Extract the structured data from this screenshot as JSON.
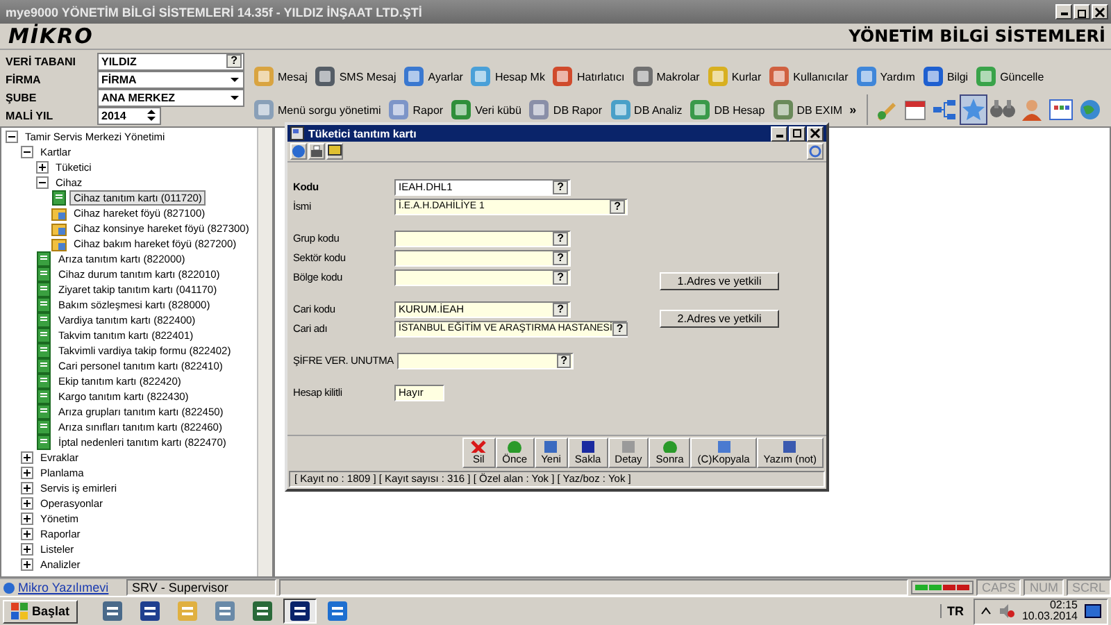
{
  "window": {
    "title": "mye9000 YÖNETİM BİLGİ SİSTEMLERİ 14.35f - YILDIZ İNŞAAT LTD.ŞTİ"
  },
  "header": {
    "logo": "MİKRO",
    "product": "YÖNETİM BİLGİ SİSTEMLERİ"
  },
  "session_fields": [
    {
      "label": "VERİ TABANI",
      "value": "YILDIZ",
      "kind": "lookup",
      "button": "?"
    },
    {
      "label": "FİRMA",
      "value": "FİRMA",
      "kind": "dropdown"
    },
    {
      "label": "ŞUBE",
      "value": "ANA MERKEZ",
      "kind": "dropdown"
    },
    {
      "label": "MALİ YIL",
      "value": "2014",
      "kind": "spinner"
    }
  ],
  "toolbar_row_1": [
    "Mesaj",
    "SMS Mesaj",
    "Ayarlar",
    "Hesap Mk",
    "Hatırlatıcı",
    "Makrolar",
    "Kurlar",
    "Kullanıcılar",
    "Yardım",
    "Bilgi",
    "Güncelle"
  ],
  "toolbar_row_2": [
    "Menü sorgu yönetimi",
    "Rapor",
    "Veri kübü",
    "DB Rapor",
    "DB Analiz",
    "DB Hesap",
    "DB EXIM"
  ],
  "toolbar_overflow": "»",
  "quick_icons": [
    {
      "selected": false
    },
    {
      "selected": false
    },
    {
      "selected": false
    },
    {
      "selected": true
    },
    {
      "selected": false
    },
    {
      "selected": false
    },
    {
      "selected": false
    },
    {
      "selected": false
    }
  ],
  "tree": {
    "label": "Tamir Servis Merkezi Yönetimi",
    "expanded": true,
    "selected": false,
    "children": [
      {
        "label": "Kartlar",
        "expanded": true,
        "selected": false,
        "children": [
          {
            "label": "Tüketici",
            "expanded": false,
            "selected": false
          },
          {
            "label": "Cihaz",
            "expanded": true,
            "selected": false,
            "children": [
              {
                "label": "Cihaz tanıtım kartı (011720)",
                "kind": "card",
                "selected": true
              },
              {
                "label": "Cihaz hareket föyü (827100)",
                "kind": "movement",
                "selected": false
              },
              {
                "label": "Cihaz konsinye hareket föyü (827300)",
                "kind": "movement",
                "selected": false
              },
              {
                "label": "Cihaz bakım hareket föyü (827200)",
                "kind": "movement",
                "selected": false
              }
            ]
          },
          {
            "label": "Arıza tanıtım kartı (822000)",
            "kind": "card",
            "selected": false
          },
          {
            "label": "Cihaz durum tanıtım kartı (822010)",
            "kind": "card",
            "selected": false
          },
          {
            "label": "Ziyaret takip tanıtım kartı (041170)",
            "kind": "card",
            "selected": false
          },
          {
            "label": "Bakım sözleşmesi kartı (828000)",
            "kind": "card",
            "selected": false
          },
          {
            "label": "Vardiya tanıtım kartı (822400)",
            "kind": "card",
            "selected": false
          },
          {
            "label": "Takvim tanıtım kartı (822401)",
            "kind": "card",
            "selected": false
          },
          {
            "label": "Takvimli vardiya takip formu (822402)",
            "kind": "card",
            "selected": false
          },
          {
            "label": "Cari personel tanıtım kartı (822410)",
            "kind": "card",
            "selected": false
          },
          {
            "label": "Ekip tanıtım kartı (822420)",
            "kind": "card",
            "selected": false
          },
          {
            "label": "Kargo tanıtım kartı (822430)",
            "kind": "card",
            "selected": false
          },
          {
            "label": "Arıza grupları tanıtım kartı (822450)",
            "kind": "card",
            "selected": false
          },
          {
            "label": "Arıza sınıfları tanıtım kartı (822460)",
            "kind": "card",
            "selected": false
          },
          {
            "label": "İptal nedenleri tanıtım kartı (822470)",
            "kind": "card",
            "selected": false
          }
        ]
      },
      {
        "label": "Evraklar",
        "expanded": false,
        "selected": false
      },
      {
        "label": "Planlama",
        "expanded": false,
        "selected": false
      },
      {
        "label": "Servis iş emirleri",
        "expanded": false,
        "selected": false
      },
      {
        "label": "Operasyonlar",
        "expanded": false,
        "selected": false
      },
      {
        "label": "Yönetim",
        "expanded": false,
        "selected": false
      },
      {
        "label": "Raporlar",
        "expanded": false,
        "selected": false
      },
      {
        "label": "Listeler",
        "expanded": false,
        "selected": false
      },
      {
        "label": "Analizler",
        "expanded": false,
        "selected": false
      }
    ]
  },
  "dialog": {
    "title": "Tüketici tanıtım kartı",
    "field_groups": [
      [
        {
          "label": "Kodu",
          "value": "IEAH.DHL1",
          "focused": true,
          "wide": false,
          "button": "?"
        },
        {
          "label": "İsmi",
          "value": "İ.E.A.H.DAHİLİYE 1",
          "focused": false,
          "wide": true,
          "button": "?"
        }
      ],
      [
        {
          "label": "Grup kodu",
          "focused": false,
          "wide": false,
          "button": "?"
        },
        {
          "label": "Sektör kodu",
          "focused": false,
          "wide": false,
          "button": "?"
        },
        {
          "label": "Bölge kodu",
          "focused": false,
          "wide": false,
          "button": "?"
        }
      ],
      [
        {
          "label": "Cari kodu",
          "value": "KURUM.İEAH",
          "focused": false,
          "wide": false,
          "button": "?"
        },
        {
          "label": "Cari adı",
          "value": "İSTANBUL EĞİTİM VE ARAŞTIRMA HASTANESİ",
          "focused": false,
          "wide": true,
          "button": "?"
        }
      ],
      [
        {
          "label": "ŞİFRE VER. UNUTMA",
          "focused": false,
          "wide": false,
          "button": "?"
        }
      ],
      [
        {
          "label": "Hesap kilitli",
          "value": "Hayır",
          "focused": false,
          "wide": false
        }
      ]
    ],
    "address_buttons": [
      "1.Adres ve yetkili",
      "2.Adres ve yetkili"
    ],
    "actions": [
      {
        "label": "Sil",
        "kind": "delete"
      },
      {
        "label": "Önce",
        "kind": "previous"
      },
      {
        "label": "Yeni",
        "kind": "new"
      },
      {
        "label": "Sakla",
        "kind": "save"
      },
      {
        "label": "Detay",
        "kind": "detail"
      },
      {
        "label": "Sonra",
        "kind": "next"
      },
      {
        "label": "(C)Kopyala",
        "kind": "copy"
      },
      {
        "label": "Yazım (not)",
        "kind": "note"
      }
    ],
    "status": "[ Kayıt no : 1809 ] [ Kayıt sayısı : 316 ] [ Özel alan : Yok ] [ Yaz/boz : Yok ]"
  },
  "status_bar": {
    "link": "Mikro Yazılımevi",
    "user": "SRV - Supervisor",
    "leds": [
      {
        "color": "#22b02a"
      },
      {
        "color": "#22b02a"
      },
      {
        "color": "#c81818"
      },
      {
        "color": "#c81818"
      }
    ],
    "keys": [
      {
        "label": "CAPS",
        "on": false
      },
      {
        "label": "NUM",
        "on": false
      },
      {
        "label": "SCRL",
        "on": false
      }
    ]
  },
  "taskbar": {
    "start": "Başlat",
    "apps": [
      {
        "selected": false
      },
      {
        "selected": false
      },
      {
        "selected": false
      },
      {
        "selected": false
      },
      {
        "selected": false
      },
      {
        "selected": true
      },
      {
        "selected": false
      }
    ],
    "language": "TR",
    "time": "02:15",
    "date": "10.03.2014"
  }
}
